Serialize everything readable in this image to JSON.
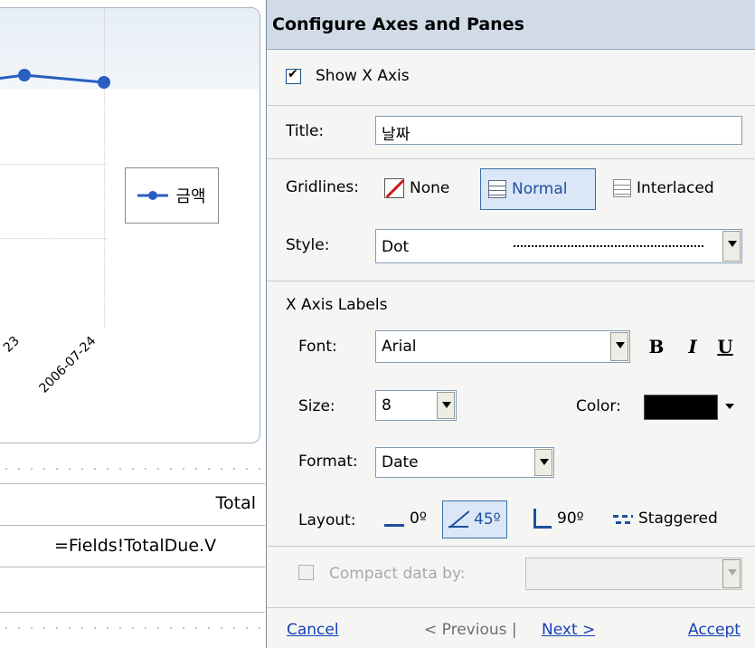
{
  "chart": {
    "x_tick_labels": [
      "23",
      "2006-07-24"
    ],
    "legend_label": "금액",
    "series_color": "#2a5ec2"
  },
  "report": {
    "total_label": "Total",
    "fields_expression": "=Fields!TotalDue.V"
  },
  "dialog": {
    "title": "Configure Axes and Panes",
    "show_x_axis": {
      "label": "Show X Axis",
      "checked": true
    },
    "title_field": {
      "label": "Title:",
      "value": "날짜"
    },
    "gridlines": {
      "label": "Gridlines:",
      "options": [
        "None",
        "Normal",
        "Interlaced"
      ],
      "selected": "Normal"
    },
    "style": {
      "label": "Style:",
      "value": "Dot"
    },
    "x_axis_labels": {
      "header": "X Axis Labels",
      "font": {
        "label": "Font:",
        "value": "Arial"
      },
      "bold_label": "B",
      "italic_label": "I",
      "underline_label": "U",
      "size": {
        "label": "Size:",
        "value": "8"
      },
      "color": {
        "label": "Color:",
        "value": "#000000"
      },
      "format": {
        "label": "Format:",
        "value": "Date"
      },
      "layout": {
        "label": "Layout:",
        "options": [
          "0º",
          "45º",
          "90º",
          "Staggered"
        ],
        "selected": "45º"
      }
    },
    "compact": {
      "label": "Compact data by:",
      "checked": false,
      "value": ""
    },
    "footer": {
      "cancel": "Cancel",
      "previous": "< Previous |",
      "next": "Next >",
      "accept": "Accept"
    }
  }
}
